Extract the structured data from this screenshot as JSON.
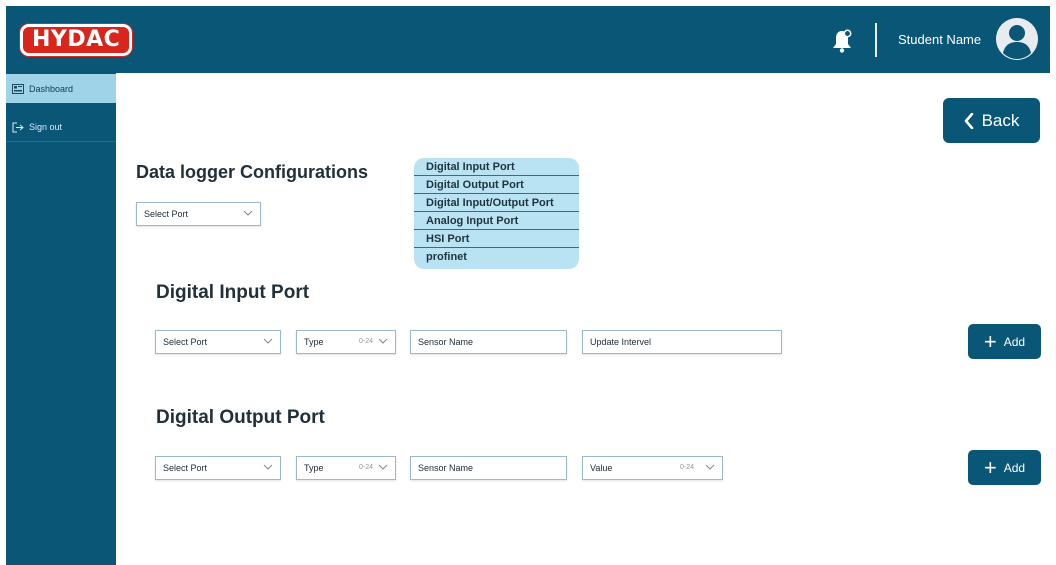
{
  "brand": {
    "logo_text": "HYDAC",
    "logo_color": "#d9261c",
    "primary_color": "#0a5677",
    "accent_color": "#9fd3e8"
  },
  "header": {
    "user_name": "Student Name",
    "notification_icon": "bell-icon",
    "avatar_icon": "user-avatar-icon"
  },
  "sidebar": {
    "items": [
      {
        "label": "Dashboard",
        "icon": "dashboard-icon",
        "active": true
      },
      {
        "label": "Sign out",
        "icon": "sign-out-icon",
        "active": false
      }
    ]
  },
  "back_button": {
    "label": "Back",
    "icon": "chevron-left-icon"
  },
  "config": {
    "title": "Data logger Configurations",
    "select_placeholder": "Select Port",
    "port_options": [
      "Digital Input Port",
      "Digital Output Port",
      "Digital Input/Output Port",
      "Analog Input Port",
      "HSI Port",
      "profinet"
    ]
  },
  "digital_input": {
    "title": "Digital Input Port",
    "select_port": "Select Port",
    "type_label": "Type",
    "type_value": "0-24",
    "sensor_name": "Sensor Name",
    "update_interval": "Update Intervel",
    "add_label": "Add"
  },
  "digital_output": {
    "title": "Digital Output Port",
    "select_port": "Select Port",
    "type_label": "Type",
    "type_value": "0-24",
    "sensor_name": "Sensor Name",
    "value_label": "Value",
    "value_value": "0-24",
    "add_label": "Add"
  }
}
